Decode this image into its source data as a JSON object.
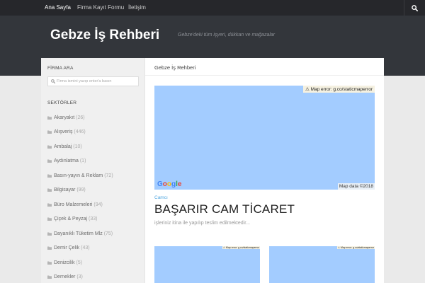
{
  "nav": {
    "items": [
      "Ana Sayfa",
      "Firma Kayıt Formu",
      "İletişim"
    ]
  },
  "header": {
    "title": "Gebze İş Rehberi",
    "description": "Gebze'deki tüm işyeri, dükkan ve mağazalar"
  },
  "sidebar": {
    "search_heading": "FİRMA ARA",
    "search_placeholder": "Firma ismini yazıp enter'a basın",
    "categories_heading": "SEKTÖRLER",
    "categories": [
      {
        "label": "Akaryakıt",
        "count": "(26)"
      },
      {
        "label": "Alışveriş",
        "count": "(446)"
      },
      {
        "label": "Ambalaj",
        "count": "(10)"
      },
      {
        "label": "Aydınlatma",
        "count": "(1)"
      },
      {
        "label": "Basın-yayın & Reklam",
        "count": "(72)"
      },
      {
        "label": "Bilgisayar",
        "count": "(99)"
      },
      {
        "label": "Büro Malzemeleri",
        "count": "(94)"
      },
      {
        "label": "Çiçek & Peyzaj",
        "count": "(33)"
      },
      {
        "label": "Dayanıklı Tüketim Mlz",
        "count": "(75)"
      },
      {
        "label": "Demir Çelik",
        "count": "(43)"
      },
      {
        "label": "Denizcilik",
        "count": "(5)"
      },
      {
        "label": "Dernekler",
        "count": "(3)"
      }
    ]
  },
  "content": {
    "heading": "Gebze İş Rehberi",
    "map": {
      "error": "Map error: g.co/staticmaperror",
      "logo": "Google",
      "data": "Map data ©2018"
    },
    "post": {
      "category": "Camcı",
      "title": "BAŞARIR CAM TİCARET",
      "excerpt": "işleriniz itina ile yapılıp teslim edilmektedir..."
    }
  }
}
